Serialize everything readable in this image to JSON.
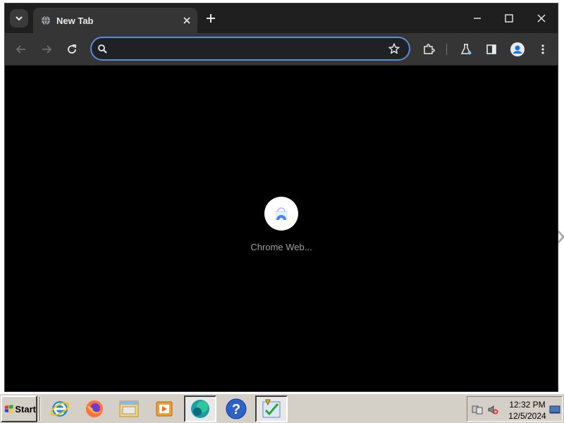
{
  "browser": {
    "tab": {
      "title": "New Tab"
    },
    "omnibox": {
      "value": "",
      "placeholder": ""
    }
  },
  "content": {
    "shortcut": {
      "label": "Chrome Web..."
    }
  },
  "taskbar": {
    "start_label": "Start",
    "apps": [
      "internet-explorer",
      "firefox",
      "file-explorer",
      "media-player",
      "chrome-web-app",
      "help",
      "task-scheduler"
    ],
    "clock": {
      "time": "12:32 PM",
      "date": "12/5/2024"
    }
  },
  "colors": {
    "omnibox_focus": "#5b8bd9",
    "toolbar": "#353535",
    "titlebar": "#1f1f1f",
    "taskbar": "#d4d0c8"
  }
}
